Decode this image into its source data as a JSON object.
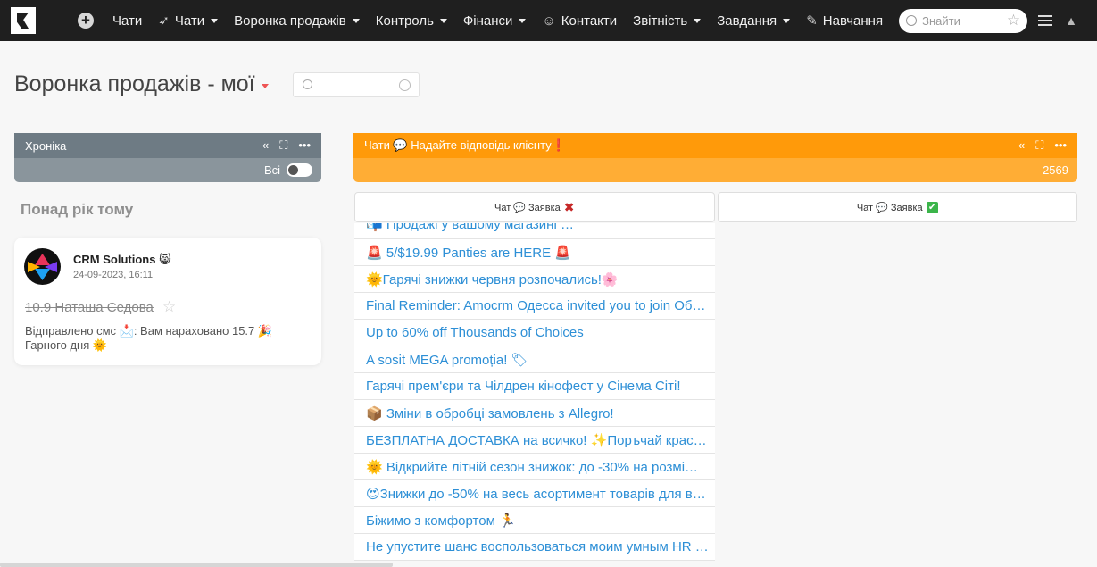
{
  "topbar": {
    "nav": [
      {
        "label": "Чати",
        "icon": "",
        "caret": false
      },
      {
        "label": "Чати",
        "icon": "rocket-icon",
        "caret": true
      },
      {
        "label": "Воронка продажів",
        "icon": "",
        "caret": true
      },
      {
        "label": "Контроль",
        "icon": "",
        "caret": true
      },
      {
        "label": "Фінанси",
        "icon": "",
        "caret": true
      },
      {
        "label": "Контакти",
        "icon": "contacts-icon",
        "caret": false
      },
      {
        "label": "Звітність",
        "icon": "",
        "caret": true
      },
      {
        "label": "Завдання",
        "icon": "",
        "caret": true
      },
      {
        "label": "Навчання",
        "icon": "paperclip-icon",
        "caret": false
      }
    ],
    "search_placeholder": "Знайти"
  },
  "page": {
    "title": "Воронка продажів - мої"
  },
  "history_column": {
    "title": "Хроніка",
    "filter_label": "Всі",
    "section_label": "Понад рік тому",
    "card": {
      "company": "CRM Solutions 😸",
      "date": "24-09-2023, 16:11",
      "deal": "10.9 Наташа Седова",
      "sms": "Відправлено смс 📩: Вам нараховано 15.7 🎉 Гарного дня 🌞"
    }
  },
  "chats_column": {
    "title": "Чати 💬 Надайте відповідь клієнту❗",
    "count": "2569",
    "tabs": [
      {
        "label": "Чат 💬 Заявка",
        "mark": "✖"
      },
      {
        "label": "Чат 💬 Заявка",
        "mark": "✔"
      }
    ],
    "items": [
      "🚨 5/$19.99 Panties are HERE 🚨",
      "🌞Гарячі знижки червня розпочались!🌸",
      "Final Reminder: Amocrm Одесса invited you to join Об…",
      "Up to 60% off Thousands of Choices",
      "A sosit MEGA promoția! 🏷",
      "Гарячі прем'єри та Чілдрен кінофест у Сінема Сіті!",
      "📦 Зміни в обробці замовлень з Allegro!",
      "БЕЗПЛАТНА ДОСТАВКА на всичко! ✨Поръчай крас…",
      "🌞 Відкрийте літній сезон знижок: до -30% на розмі…",
      "😍Знижки до -50% на весь асортимент товарів для в…",
      "Біжимо з комфортом 🏃",
      "Не упустите шанс воспользоваться моим умным HR …"
    ],
    "partial_top_item": "📬 Продажі у вашому магазині …"
  },
  "colors": {
    "topbar": "#1f1f1f",
    "history_header": "#6e7b84",
    "chats_header": "#ff9a0a",
    "link": "#2d8fd6"
  }
}
